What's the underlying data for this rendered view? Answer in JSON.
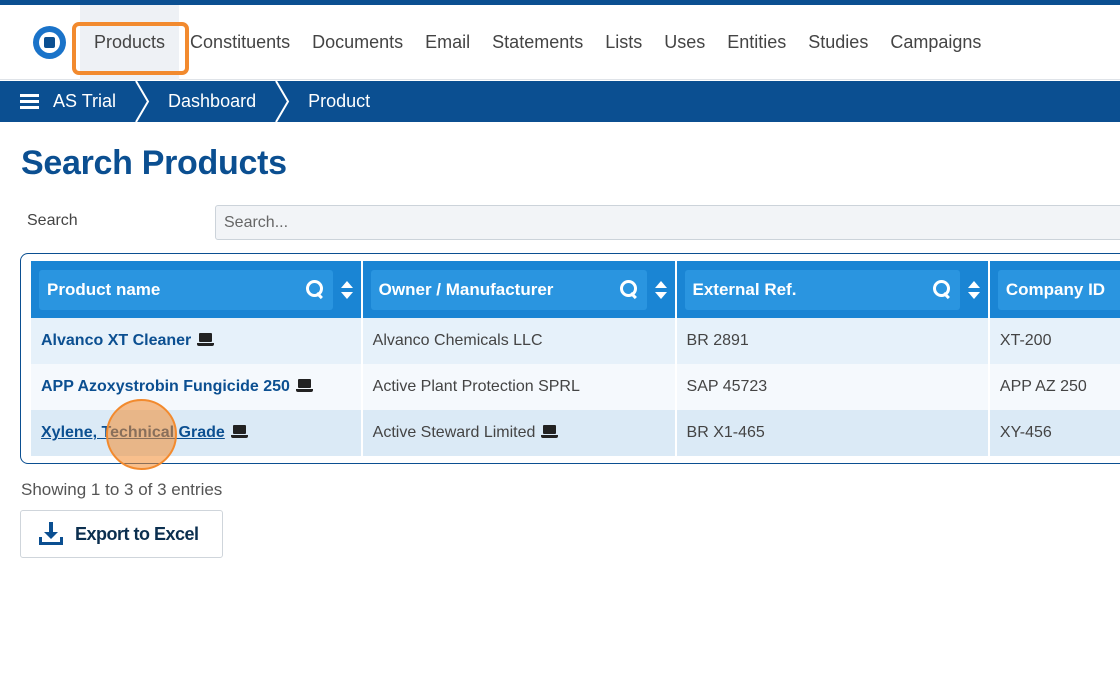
{
  "nav": {
    "items": [
      {
        "label": "Products",
        "active": true
      },
      {
        "label": "Constituents"
      },
      {
        "label": "Documents"
      },
      {
        "label": "Email"
      },
      {
        "label": "Statements"
      },
      {
        "label": "Lists"
      },
      {
        "label": "Uses"
      },
      {
        "label": "Entities"
      },
      {
        "label": "Studies"
      },
      {
        "label": "Campaigns"
      }
    ]
  },
  "breadcrumb": [
    "AS Trial",
    "Dashboard",
    "Product"
  ],
  "page": {
    "title": "Search Products"
  },
  "search": {
    "label": "Search",
    "placeholder": "Search..."
  },
  "table": {
    "columns": [
      "Product name",
      "Owner / Manufacturer",
      "External Ref.",
      "Company ID"
    ],
    "rows": [
      {
        "name": "Alvanco XT Cleaner",
        "owner": "Alvanco Chemicals LLC",
        "ref": "BR 2891",
        "company_id": "XT-200"
      },
      {
        "name": "APP Azoxystrobin Fungicide 250",
        "owner": "Active Plant Protection SPRL",
        "ref": "SAP 45723",
        "company_id": "APP AZ 250"
      },
      {
        "name": "Xylene, Technical Grade",
        "owner": "Active Steward Limited",
        "ref": "BR X1-465",
        "company_id": "XY-456"
      }
    ]
  },
  "footer": {
    "entries": "Showing 1 to 3 of 3 entries",
    "export_label": "Export to Excel"
  },
  "colors": {
    "brand": "#0b4f91",
    "header": "#1a85d4",
    "highlight": "#f28a2e"
  }
}
